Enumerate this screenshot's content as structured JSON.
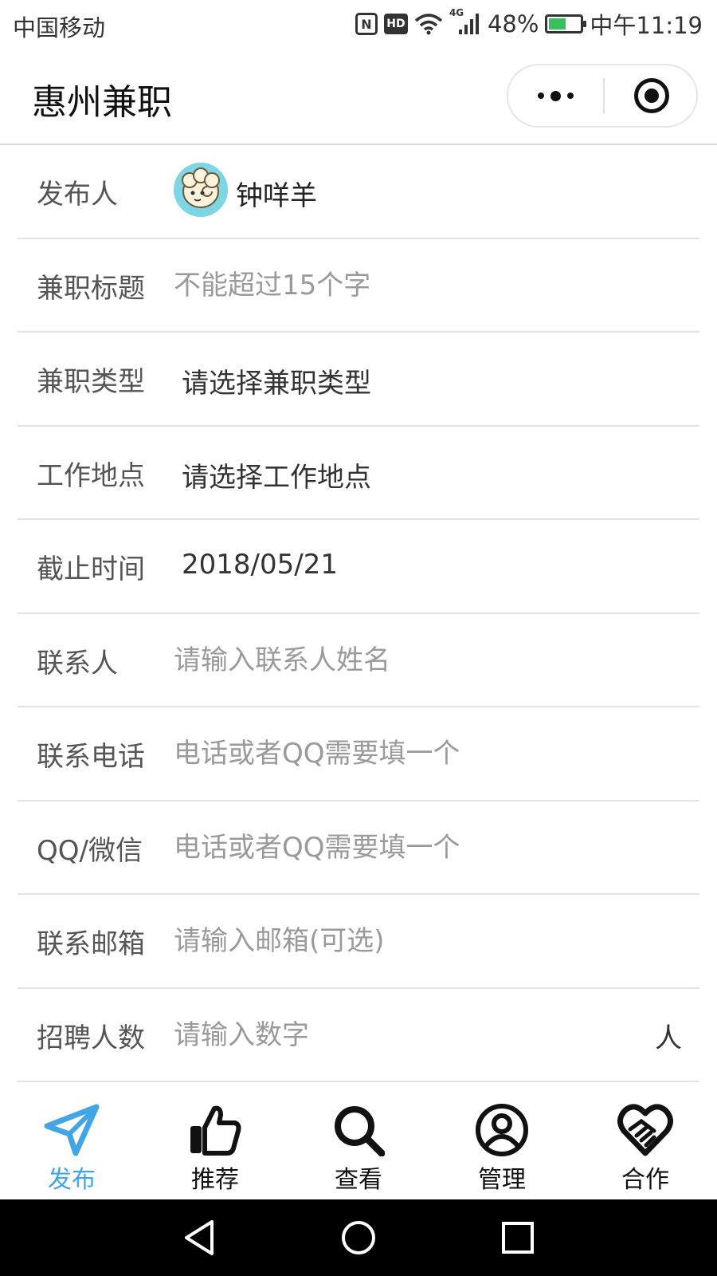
{
  "status_bar": {
    "carrier": "中国移动",
    "nfc_label": "N",
    "hd_label": "HD",
    "network": "4G",
    "battery_percent": "48%",
    "battery_level": 0.48,
    "time": "中午11:19",
    "icons": [
      "nfc-icon",
      "hd-icon",
      "wifi-icon",
      "signal-icon",
      "battery-icon"
    ]
  },
  "nav": {
    "title": "惠州兼职",
    "more_icon": "more-dots-icon",
    "close_icon": "target-close-icon"
  },
  "form": {
    "publisher": {
      "label": "发布人",
      "name": "钟咩羊",
      "avatar_icon": "sheep-avatar"
    },
    "title": {
      "label": "兼职标题",
      "placeholder": "不能超过15个字"
    },
    "type": {
      "label": "兼职类型",
      "value": "请选择兼职类型"
    },
    "location": {
      "label": "工作地点",
      "value": "请选择工作地点"
    },
    "deadline": {
      "label": "截止时间",
      "value": "2018/05/21"
    },
    "contact_name": {
      "label": "联系人",
      "placeholder": "请输入联系人姓名"
    },
    "phone": {
      "label": "联系电话",
      "placeholder": "电话或者QQ需要填一个"
    },
    "qq_wechat": {
      "label": "QQ/微信",
      "placeholder": "电话或者QQ需要填一个"
    },
    "email": {
      "label": "联系邮箱",
      "placeholder": "请输入邮箱(可选)"
    },
    "headcount": {
      "label": "招聘人数",
      "placeholder": "请输入数字",
      "unit": "人"
    }
  },
  "tabs": [
    {
      "label": "发布",
      "icon": "paper-plane-icon",
      "active": true
    },
    {
      "label": "推荐",
      "icon": "thumbs-up-icon",
      "active": false
    },
    {
      "label": "查看",
      "icon": "search-icon",
      "active": false
    },
    {
      "label": "管理",
      "icon": "user-circle-icon",
      "active": false
    },
    {
      "label": "合作",
      "icon": "handshake-heart-icon",
      "active": false
    }
  ],
  "colors": {
    "accent": "#42a5e6",
    "battery": "#35c15b",
    "text": "#333333",
    "placeholder": "#9a9a9a",
    "divider": "#e3e3e3",
    "system_nav": "#000000"
  }
}
